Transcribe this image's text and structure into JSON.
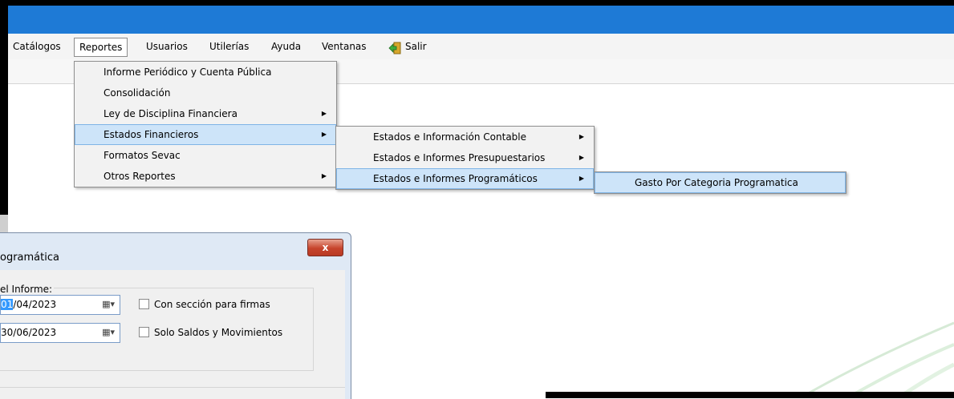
{
  "menubar": {
    "items": [
      {
        "label": "Catálogos"
      },
      {
        "label": "Reportes"
      },
      {
        "label": "Usuarios"
      },
      {
        "label": "Utilerías"
      },
      {
        "label": "Ayuda"
      },
      {
        "label": "Ventanas"
      },
      {
        "label": "Salir",
        "icon": "exit-icon"
      }
    ]
  },
  "reportes_menu": {
    "items": [
      {
        "label": "Informe Periódico y Cuenta Pública"
      },
      {
        "label": "Consolidación"
      },
      {
        "label": "Ley de Disciplina Financiera"
      },
      {
        "label": "Estados Financieros"
      },
      {
        "label": "Formatos Sevac"
      },
      {
        "label": "Otros Reportes"
      }
    ]
  },
  "estados_financieros_menu": {
    "items": [
      {
        "label": "Estados e Información Contable"
      },
      {
        "label": "Estados e Informes Presupuestarios"
      },
      {
        "label": "Estados e Informes Programáticos"
      }
    ]
  },
  "programaticos_menu": {
    "items": [
      {
        "label": "Gasto Por Categoria Programatica"
      }
    ]
  },
  "dialog": {
    "title": "ogramática",
    "close_label": "x",
    "group_label": "el Informe:",
    "date_from_sel": "01",
    "date_from_rest": "/04/2023",
    "date_to": "30/06/2023",
    "check_firmas": "Con sección para firmas",
    "check_saldos": "Solo Saldos y Movimientos"
  },
  "colors": {
    "titlebar": "#1e7ad6",
    "menu_highlight": "#cde4f9",
    "close_button": "#c6442c"
  }
}
